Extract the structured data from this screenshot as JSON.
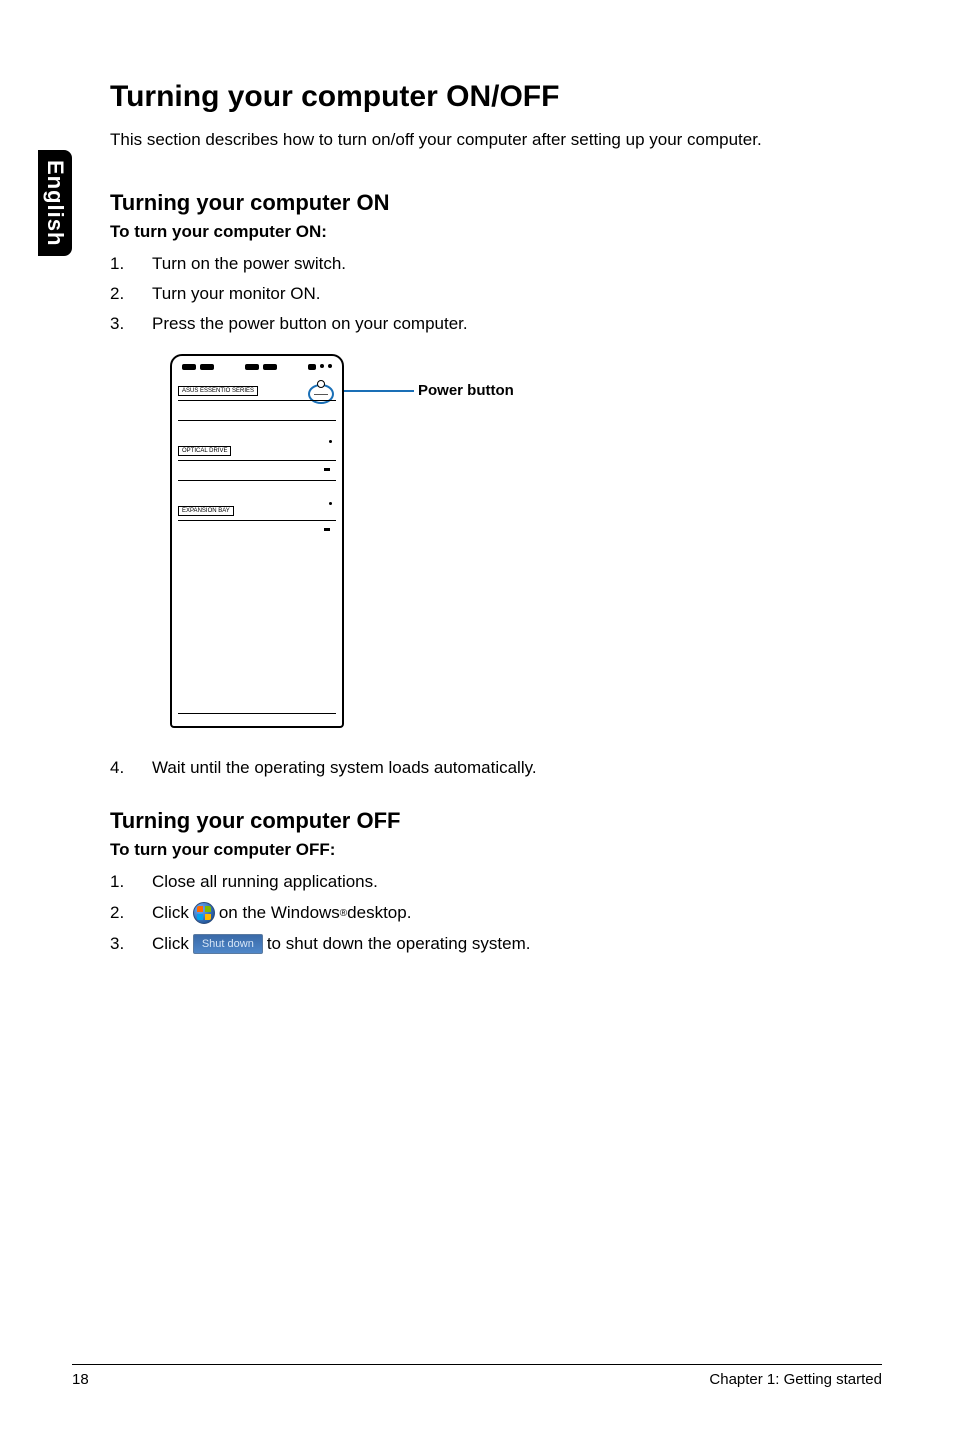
{
  "sideTab": "English",
  "title": "Turning your computer ON/OFF",
  "intro": "This section describes how to turn on/off your computer after setting up your computer.",
  "on": {
    "heading": "Turning your computer ON",
    "sub": "To turn your computer ON:",
    "steps": [
      "Turn on the power switch.",
      "Turn your monitor ON.",
      "Press the power button on your computer."
    ],
    "step4": "Wait until the operating system loads automatically."
  },
  "figure": {
    "callout": "Power button",
    "labels": {
      "brand": "ASUS ESSENTIO SERIES",
      "optical": "OPTICAL DRIVE",
      "expansion": "EXPANSION BAY"
    }
  },
  "off": {
    "heading": "Turning your computer OFF",
    "sub": "To turn your computer OFF:",
    "step1": "Close all running applications.",
    "step2_a": "Click",
    "step2_b": "on the Windows",
    "step2_c": " desktop.",
    "step3_a": "Click",
    "step3_b": "to shut down the operating system.",
    "shutdownLabel": "Shut down"
  },
  "footer": {
    "page": "18",
    "chapter": "Chapter 1: Getting started"
  }
}
